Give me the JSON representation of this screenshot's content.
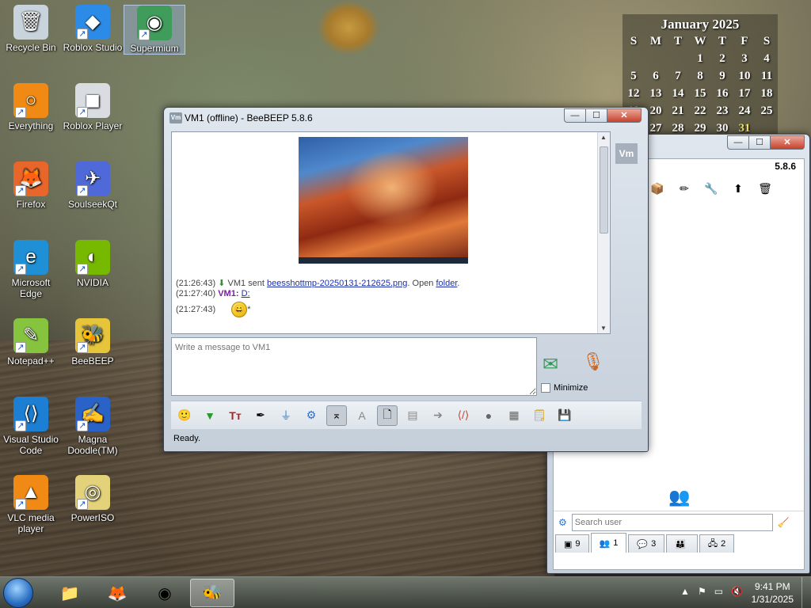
{
  "desktop": {
    "icons": [
      {
        "label": "Recycle Bin",
        "glyph": "🗑",
        "color": "#c8d3dc",
        "shortcut": false
      },
      {
        "label": "Roblox Studio",
        "glyph": "◆",
        "color": "#2b8be6",
        "shortcut": true
      },
      {
        "label": "Supermium",
        "glyph": "◉",
        "color": "#3f9c5a",
        "shortcut": true,
        "selected": true
      },
      {
        "label": "Everything",
        "glyph": "○",
        "color": "#f08a14",
        "shortcut": true
      },
      {
        "label": "Roblox Player",
        "glyph": "◼",
        "color": "#d9dde2",
        "shortcut": true
      },
      {
        "label": "Firefox",
        "glyph": "🦊",
        "color": "#e8662a",
        "shortcut": true
      },
      {
        "label": "SoulseekQt",
        "glyph": "✈",
        "color": "#4f6ad8",
        "shortcut": true
      },
      {
        "label": "Microsoft Edge",
        "glyph": "e",
        "color": "#1f8fd6",
        "shortcut": true
      },
      {
        "label": "NVIDIA",
        "glyph": "◐",
        "color": "#76b900",
        "shortcut": true
      },
      {
        "label": "Notepad++",
        "glyph": "✎",
        "color": "#86c440",
        "shortcut": true
      },
      {
        "label": "BeeBEEP",
        "glyph": "🐝",
        "color": "#e6c53a",
        "shortcut": true
      },
      {
        "label": "Visual Studio Code",
        "glyph": "⟨⟩",
        "color": "#1c7fd3",
        "shortcut": true
      },
      {
        "label": "Magna Doodle(TM)",
        "glyph": "✍",
        "color": "#2a63c8",
        "shortcut": true
      },
      {
        "label": "VLC media player",
        "glyph": "▲",
        "color": "#f08a14",
        "shortcut": true
      },
      {
        "label": "PowerISO",
        "glyph": "◎",
        "color": "#e3d27a",
        "shortcut": true
      }
    ]
  },
  "calendar": {
    "title": "January 2025",
    "weekdays": [
      "S",
      "M",
      "T",
      "W",
      "T",
      "F",
      "S"
    ],
    "weeks": [
      [
        "",
        "",
        "",
        "1",
        "2",
        "3",
        "4"
      ],
      [
        "5",
        "6",
        "7",
        "8",
        "9",
        "10",
        "11"
      ],
      [
        "12",
        "13",
        "14",
        "15",
        "16",
        "17",
        "18"
      ],
      [
        "19",
        "20",
        "21",
        "22",
        "23",
        "24",
        "25"
      ],
      [
        "26",
        "27",
        "28",
        "29",
        "30",
        "31",
        ""
      ]
    ],
    "today": "31"
  },
  "chat_window": {
    "title": "VM1 (offline) - BeeBEEP 5.8.6",
    "app_icon": "Vm",
    "buttons": {
      "minimize": "—",
      "maximize": "☐",
      "close": "✕"
    },
    "avatar_label": "Vm",
    "messages": [
      {
        "time": "(21:26:43)",
        "prefix": "VM1 sent ",
        "link": "beesshottmp-20250131-212625.png",
        "mid": ". Open ",
        "link2": "folder",
        "suffix": "."
      },
      {
        "time": "(21:27:40)",
        "nick": "VM1:",
        "text": "D:"
      },
      {
        "time": "(21:27:43)",
        "emoji": "😄",
        "suffix": "*"
      }
    ],
    "input_placeholder": "Write a message to VM1",
    "minimize_label": "Minimize",
    "status": "Ready."
  },
  "main_window": {
    "buttons": {
      "minimize": "—",
      "maximize": "☐",
      "close": "✕"
    },
    "version": "5.8.6",
    "search_placeholder": "Search user",
    "tabs": [
      {
        "icon": "chat-icon",
        "glyph": "▣",
        "label": "9"
      },
      {
        "icon": "users-icon",
        "glyph": "👥",
        "label": "1"
      },
      {
        "icon": "chat-groups-icon",
        "glyph": "💬",
        "label": "3"
      },
      {
        "icon": "group-icon",
        "glyph": "👪",
        "label": ""
      },
      {
        "icon": "network-icon",
        "glyph": "🖧",
        "label": "2"
      }
    ]
  },
  "taskbar": {
    "clock_time": "9:41 PM",
    "clock_date": "1/31/2025",
    "tray_icons": [
      "▲",
      "⚑",
      "▭",
      "🔇"
    ]
  }
}
